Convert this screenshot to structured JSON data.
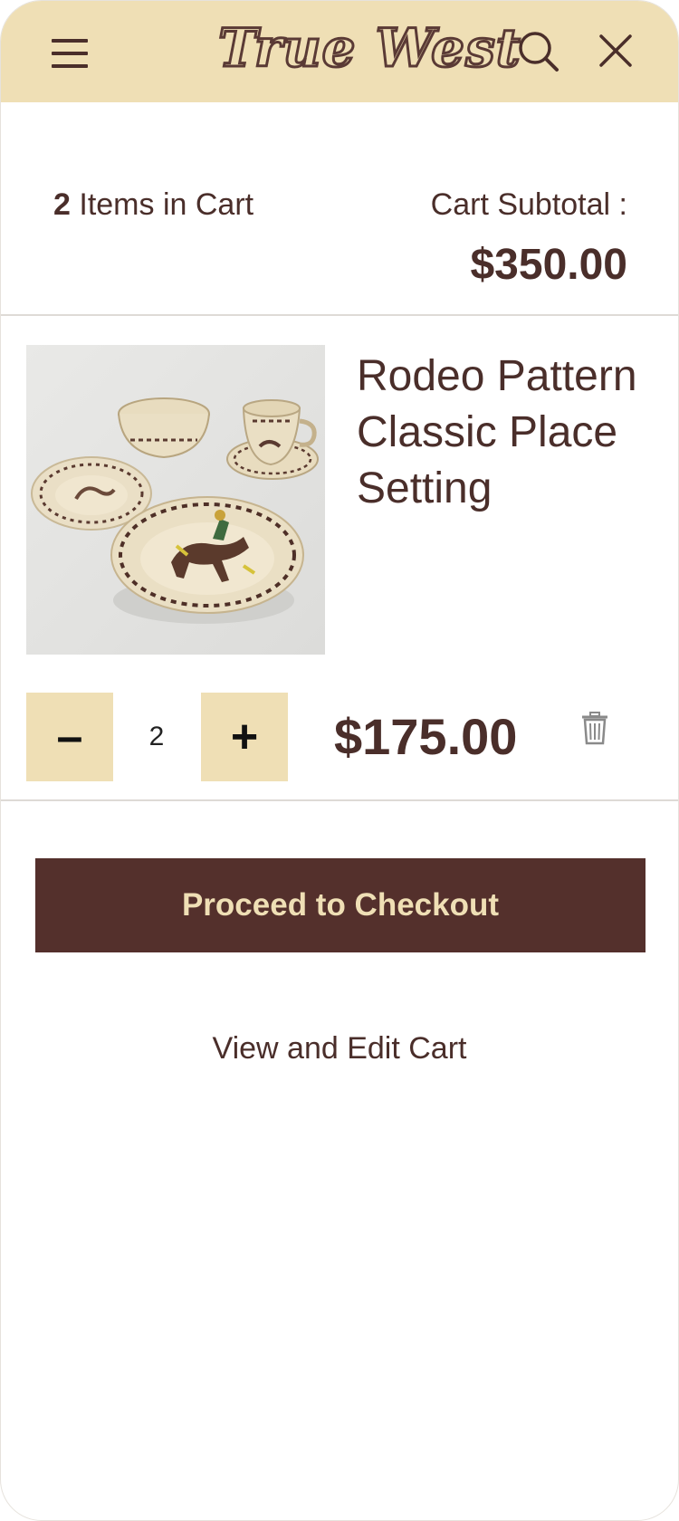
{
  "header": {
    "logo_text": "True West",
    "menu_icon": "hamburger-icon",
    "search_icon": "search-icon",
    "close_icon": "close-icon",
    "background_color": "#efdfb5"
  },
  "summary": {
    "item_count": "2",
    "items_label": "Items in Cart",
    "subtotal_label": "Cart Subtotal :",
    "subtotal_value": "$350.00"
  },
  "cart_items": [
    {
      "name": "Rodeo Pattern Classic Place Setting",
      "quantity": "2",
      "decrement_label": "–",
      "increment_label": "+",
      "price": "$175.00",
      "remove_icon": "trash-icon"
    }
  ],
  "actions": {
    "checkout_label": "Proceed to Checkout",
    "view_edit_label": "View and Edit Cart"
  },
  "colors": {
    "brand_dark": "#54302c",
    "brand_light": "#efdfb5",
    "text": "#4a2e2a"
  }
}
